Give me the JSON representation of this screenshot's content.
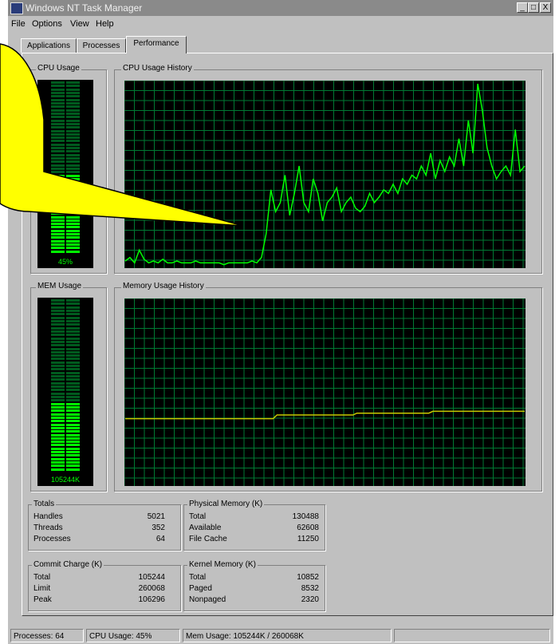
{
  "window": {
    "title": "Windows NT Task Manager"
  },
  "caption_buttons": {
    "minimize": "_",
    "maximize": "□",
    "close": "X"
  },
  "menu": [
    "File",
    "Options",
    "View",
    "Help"
  ],
  "tabs": [
    "Applications",
    "Processes",
    "Performance"
  ],
  "active_tab": "Performance",
  "cpu": {
    "usage_label": "CPU Usage",
    "history_label": "CPU Usage History",
    "value_text": "45%",
    "fraction": 0.45
  },
  "mem": {
    "usage_label": "MEM Usage",
    "history_label": "Memory Usage History",
    "value_text": "105244K",
    "fraction": 0.4
  },
  "totals": {
    "label": "Totals",
    "rows": [
      {
        "label": "Handles",
        "value": "5021"
      },
      {
        "label": "Threads",
        "value": "352"
      },
      {
        "label": "Processes",
        "value": "64"
      }
    ]
  },
  "physical_memory": {
    "label": "Physical Memory (K)",
    "rows": [
      {
        "label": "Total",
        "value": "130488"
      },
      {
        "label": "Available",
        "value": "62608"
      },
      {
        "label": "File Cache",
        "value": "11250"
      }
    ]
  },
  "commit_charge": {
    "label": "Commit Charge (K)",
    "rows": [
      {
        "label": "Total",
        "value": "105244"
      },
      {
        "label": "Limit",
        "value": "260068"
      },
      {
        "label": "Peak",
        "value": "106296"
      }
    ]
  },
  "kernel_memory": {
    "label": "Kernel Memory (K)",
    "rows": [
      {
        "label": "Total",
        "value": "10852"
      },
      {
        "label": "Paged",
        "value": "8532"
      },
      {
        "label": "Nonpaged",
        "value": "2320"
      }
    ]
  },
  "status": {
    "processes": "Processes: 64",
    "cpu": "CPU Usage: 45%",
    "mem": "Mem Usage: 105244K / 260068K"
  },
  "colors": {
    "grid": "#007a33",
    "cpu_line": "#00ff00",
    "mem_line": "#c8c800",
    "meter_on": "#00ff00",
    "meter_off": "#005a1e",
    "callout": "#ffff00"
  },
  "chart_data": [
    {
      "type": "line",
      "series": [
        {
          "values": [
            3,
            5,
            2,
            9,
            4,
            2,
            3,
            2,
            4,
            2,
            2,
            3,
            2,
            2,
            2,
            3,
            2,
            2,
            2,
            2,
            2,
            1,
            2,
            2,
            2,
            2,
            2,
            3,
            2,
            5,
            18,
            42,
            30,
            35,
            50,
            28,
            40,
            55,
            35,
            30,
            48,
            40,
            25,
            35,
            38,
            43,
            30,
            35,
            38,
            32,
            30,
            33,
            40,
            35,
            38,
            42,
            40,
            45,
            40,
            48,
            45,
            50,
            48,
            55,
            50,
            62,
            48,
            58,
            52,
            60,
            55,
            70,
            55,
            80,
            62,
            100,
            85,
            65,
            55,
            48,
            52,
            55,
            50,
            75,
            52,
            55
          ],
          "ylim": [
            0,
            100
          ]
        }
      ]
    },
    {
      "type": "line",
      "series": [
        {
          "values": [
            36,
            36,
            36,
            36,
            36,
            36,
            36,
            36,
            36,
            36,
            36,
            36,
            36,
            36,
            36,
            36,
            36,
            36,
            36,
            36,
            36,
            36,
            36,
            36,
            36,
            36,
            36,
            36,
            36,
            36,
            36,
            36,
            36,
            36,
            36,
            36,
            36,
            36,
            38,
            38,
            38,
            38,
            38,
            38,
            38,
            38,
            38,
            38,
            38,
            38,
            38,
            38,
            38,
            38,
            38,
            38,
            38,
            38,
            39,
            39,
            39,
            39,
            39,
            39,
            39,
            39,
            39,
            39,
            39,
            39,
            39,
            39,
            39,
            39,
            39,
            39,
            39,
            40,
            40,
            40,
            40,
            40,
            40,
            40,
            40,
            40,
            40,
            40,
            40,
            40,
            40,
            40,
            40,
            40,
            40,
            40,
            40,
            40,
            40,
            40,
            40
          ],
          "ylim": [
            0,
            100
          ]
        }
      ]
    }
  ]
}
